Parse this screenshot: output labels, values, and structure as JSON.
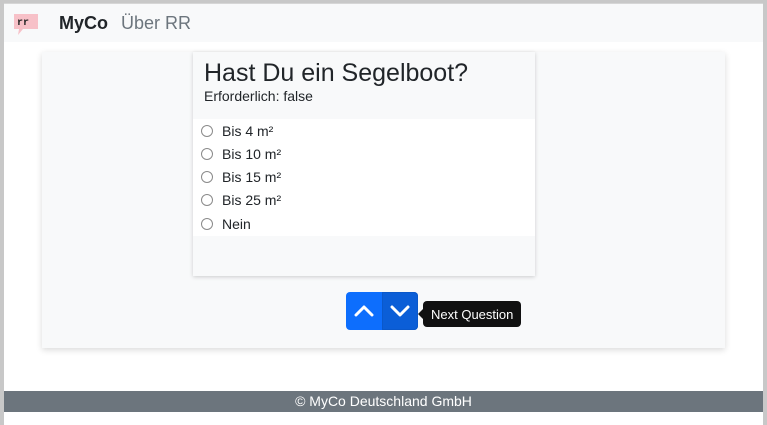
{
  "navbar": {
    "logo_text": "rr",
    "brand": "MyCo",
    "about_link": "Über RR"
  },
  "question": {
    "title": "Hast Du ein Segelboot?",
    "required_text": "Erforderlich: false",
    "options": [
      "Bis 4 m²",
      "Bis 10 m²",
      "Bis 15 m²",
      "Bis 25 m²",
      "Nein"
    ]
  },
  "navigation": {
    "prev_icon": "chevron-up-icon",
    "next_icon": "chevron-down-icon",
    "tooltip": "Next Question"
  },
  "footer": {
    "text": "© MyCo Deutschland GmbH"
  },
  "colors": {
    "primary": "#0d6efd",
    "footer_bg": "#6c757d",
    "logo_pink": "#f7c1c8"
  }
}
